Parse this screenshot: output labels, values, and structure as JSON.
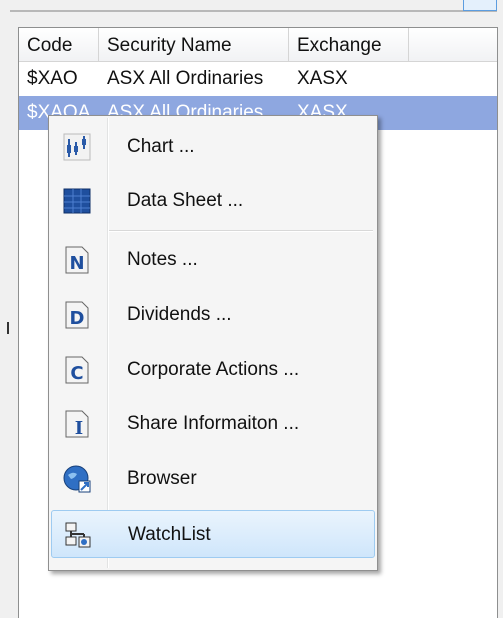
{
  "table": {
    "columns": [
      "Code",
      "Security Name",
      "Exchange"
    ],
    "rows": [
      {
        "code": "$XAO",
        "name": "ASX All Ordinaries",
        "exchange": "XASX"
      },
      {
        "code": "$XAOA",
        "name": "ASX All Ordinaries",
        "exchange": "XASX"
      }
    ]
  },
  "menu": {
    "items": [
      {
        "label": "Chart ...",
        "icon": "chart-icon"
      },
      {
        "label": "Data Sheet ...",
        "icon": "data-sheet-icon"
      },
      {
        "label": "Notes ...",
        "icon": "notes-icon"
      },
      {
        "label": "Dividends ...",
        "icon": "dividends-icon"
      },
      {
        "label": "Corporate Actions ...",
        "icon": "corporate-actions-icon"
      },
      {
        "label": "Share Informaiton ...",
        "icon": "share-information-icon"
      },
      {
        "label": "Browser",
        "icon": "browser-icon"
      },
      {
        "label": "WatchList",
        "icon": "watchlist-icon"
      }
    ],
    "highlighted_index": 7
  },
  "colors": {
    "selected_row": "#8ea7e0",
    "menu_highlight": "#cfe6fb",
    "icon_blue": "#2a5aa8"
  }
}
